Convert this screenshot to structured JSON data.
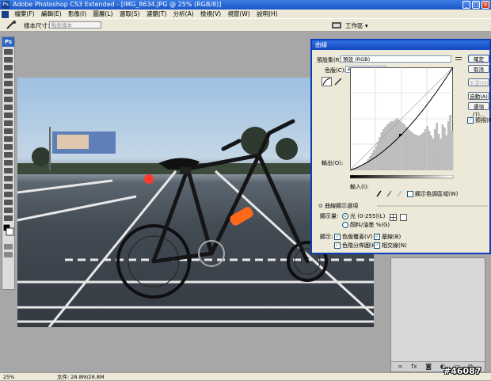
{
  "window": {
    "title": "Adobe Photoshop CS3 Extended - [IMG_8634.JPG @ 25% (RGB/8)]"
  },
  "menu": [
    "檔案(F)",
    "編輯(E)",
    "影像(I)",
    "圖層(L)",
    "選取(S)",
    "濾鏡(T)",
    "分析(A)",
    "檢視(V)",
    "視窗(W)",
    "說明(H)"
  ],
  "options": {
    "sample_label": "樣本尺寸:",
    "sample_value": "點狀樣本",
    "workspace": "工作區 ▾"
  },
  "curves": {
    "title": "曲線",
    "preset_label": "預設集(R):",
    "preset_value": "預設 (RGB)",
    "channel_label": "色版(C):",
    "channel_value": "RGB",
    "output_label": "輸出(O):",
    "input_label": "輸入(I):",
    "clipping_label": "顯示色調區域(W)",
    "display_options_label": "曲線顯示選項",
    "show_amount_label": "顯示量:",
    "light_option": "光 (0-255)(L)",
    "pigment_option": "顏料/油墨 %(G)",
    "show_label": "顯示:",
    "channel_overlays": "色版覆蓋(V)",
    "baseline": "基線(B)",
    "histogram": "色階分佈圖(H)",
    "intersection": "相交線(N)",
    "buttons": {
      "ok": "確定",
      "cancel": "取消",
      "smooth": "平滑(M)",
      "auto": "自動(A)",
      "options": "選項(T)..."
    },
    "preview_label": "預視(P)",
    "histogram_bins": [
      2,
      2,
      3,
      3,
      4,
      5,
      6,
      8,
      10,
      14,
      18,
      22,
      26,
      30,
      36,
      42,
      48,
      52,
      55,
      58,
      60,
      62,
      62,
      64,
      66,
      64,
      62,
      60,
      58,
      55,
      52,
      50,
      48,
      46,
      45,
      44,
      44,
      46,
      48,
      52,
      56,
      50,
      44,
      40,
      52,
      60,
      46,
      40,
      58,
      54,
      44,
      62,
      70,
      50
    ]
  },
  "status": {
    "zoom": "25%",
    "doc": "文件: 28.8M/28.8M"
  },
  "watermark": "#46087",
  "colors": {
    "title_bar": "#1a56c8",
    "dialog_border": "#0a3fba",
    "curve": "#000000"
  }
}
